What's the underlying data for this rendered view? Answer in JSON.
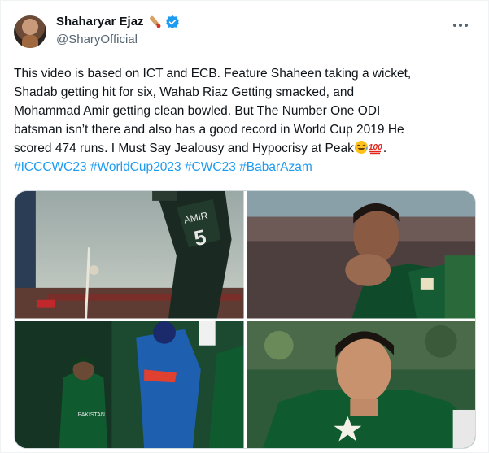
{
  "author": {
    "display_name": "Shaharyar Ejaz",
    "handle": "@SharyOfficial",
    "verified": true,
    "name_emoji": "cricket-bat-emoji"
  },
  "tweet": {
    "lines": [
      "This video is based on ICT and ECB.  Feature Shaheen taking a wicket,",
      "Shadab getting hit for six, Wahab Riaz Getting smacked, and",
      "Mohammad Amir getting clean bowled. But The Number One ODI",
      "batsman isn’t there and also has a good record in World Cup 2019 He"
    ],
    "last_line": "scored 474 runs. I Must Say Jealousy and Hypocrisy at Peak",
    "last_line_end": ".",
    "emojis": [
      "face-with-tears-of-joy-emoji",
      "hundred-points-emoji"
    ],
    "hashtags": [
      "#ICCCWC23",
      "#WorldCup2023",
      "#CWC23",
      "#BabarAzam"
    ]
  },
  "media": {
    "images": [
      {
        "name": "amir-bowled-image",
        "jersey_text": "AMIR",
        "jersey_number": "5"
      },
      {
        "name": "wahab-riaz-image"
      },
      {
        "name": "shadab-hit-for-six-image",
        "jersey_text": "PAKISTAN"
      },
      {
        "name": "shaheen-wicket-image"
      }
    ]
  },
  "colors": {
    "accent": "#1d9bf0",
    "text": "#0f1419",
    "secondary": "#536471",
    "pakistan_green": "#0f5a2e"
  }
}
